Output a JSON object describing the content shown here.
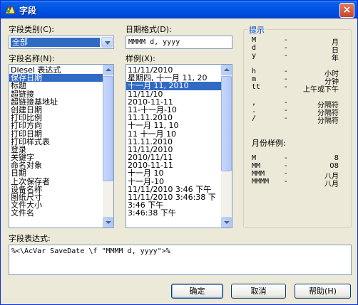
{
  "window": {
    "title": "字段",
    "close_label": "×"
  },
  "field_category": {
    "label": "字段类别(C):",
    "selected": "全部"
  },
  "field_names": {
    "label": "字段名称(N):",
    "items": [
      "Diesel 表达式",
      "保存日期",
      "标题",
      "超链接",
      "超链接基地址",
      "创建日期",
      "打印比例",
      "打印方向",
      "打印日期",
      "打印样式表",
      "登录",
      "关键字",
      "命名对象",
      "日期",
      "上次保存者",
      "设备名称",
      "图纸尺寸",
      "文件大小",
      "文件名"
    ],
    "selected_index": 1
  },
  "date_format": {
    "label": "日期格式(D):",
    "value": "MMMM d, yyyy"
  },
  "examples": {
    "label": "样例(X):",
    "items": [
      "11/11/2010",
      "星期四, 十一月 11, 20",
      "十一月 11, 2010",
      "11/11/10",
      "2010-11-11",
      "11-十一月-10",
      "11.11.2010",
      "十一月 11, 10",
      "11 十一月 10",
      "11.11.2010",
      "11/11/2010",
      "2010/11/11",
      "2010-11-11",
      "十一月 10",
      "十一月-10",
      "11/11/2010 3:46 下午",
      "11/11/2010 3:46:38 下",
      "3:46 下午",
      "3:46:38 下午"
    ],
    "selected_index": 2
  },
  "hints": {
    "title": "提示",
    "rows": [
      {
        "key": "M",
        "dash": "-",
        "value": "月"
      },
      {
        "key": "d",
        "dash": "-",
        "value": "日"
      },
      {
        "key": "y",
        "dash": "-",
        "value": "年"
      },
      {
        "key": "h",
        "dash": "-",
        "value": "小时"
      },
      {
        "key": "m",
        "dash": "-",
        "value": "分钟"
      },
      {
        "key": "tt",
        "dash": "-",
        "value": "上午或下午"
      },
      {
        "key": ",",
        "dash": "-",
        "value": "分隔符"
      },
      {
        "key": ".",
        "dash": "-",
        "value": "分隔符"
      },
      {
        "key": "/",
        "dash": "-",
        "value": "分隔符"
      }
    ],
    "month_title": "月份样例:",
    "month_rows": [
      {
        "key": "M",
        "dash": "-",
        "value": "8"
      },
      {
        "key": "MM",
        "dash": "-",
        "value": "08"
      },
      {
        "key": "MMM",
        "dash": "-",
        "value": "八月"
      },
      {
        "key": "MMMM",
        "dash": "-",
        "value": "八月"
      }
    ]
  },
  "field_expression": {
    "label": "字段表达式:",
    "value": "%<\\AcVar SaveDate \\f \"MMMM d, yyyy\">%"
  },
  "buttons": {
    "ok": "确定",
    "cancel": "取消",
    "help": "帮助(H)"
  }
}
